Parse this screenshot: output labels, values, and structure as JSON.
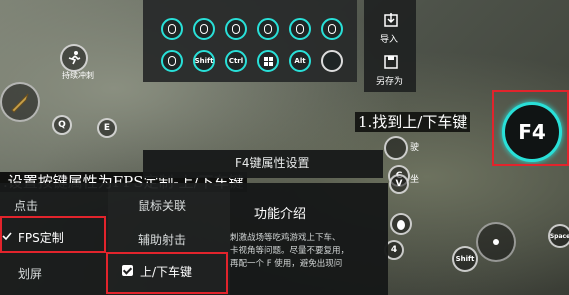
{
  "palette": {
    "row1": [
      "mouse-left-icon",
      "mouse-right-icon",
      "mouse-middle-icon",
      "mouse-scroll-icon",
      "mouse-forward-icon",
      "mouse-back-icon"
    ],
    "row2_labels": [
      "",
      "Shift",
      "Ctrl",
      "",
      "Alt",
      ""
    ]
  },
  "toolbar": {
    "import_label": "导入",
    "save_as_label": "另存为"
  },
  "game_buttons": {
    "sprint_label": "持续冲刺",
    "q_label": "Q",
    "e_label": "E",
    "c_label": "C",
    "v_label": "V",
    "four_label": "4",
    "shift_label": "Shift",
    "space_label": "Space",
    "f4_label": "F4",
    "side_text_1": "驶",
    "side_text_2": "坐"
  },
  "settings": {
    "title": "F4键属性设置",
    "left_menu": [
      "点击",
      "FPS定制",
      "划屏"
    ],
    "mid_menu": [
      "鼠标关联",
      "辅助射击",
      "上/下车键"
    ],
    "info_title": "功能介绍",
    "info_text_lines": [
      "刺激战场等吃鸡游戏上下车、",
      "卡视角等问题。尽量不要复用，",
      "再配一个 F 使用，避免出现问"
    ]
  },
  "annotations": {
    "step1": "1.找到上/下车键",
    "step2": ".设置按键属性为FPS定制-上/下车键"
  },
  "colors": {
    "accent": "#29e0d8",
    "highlight": "#e2242c"
  }
}
